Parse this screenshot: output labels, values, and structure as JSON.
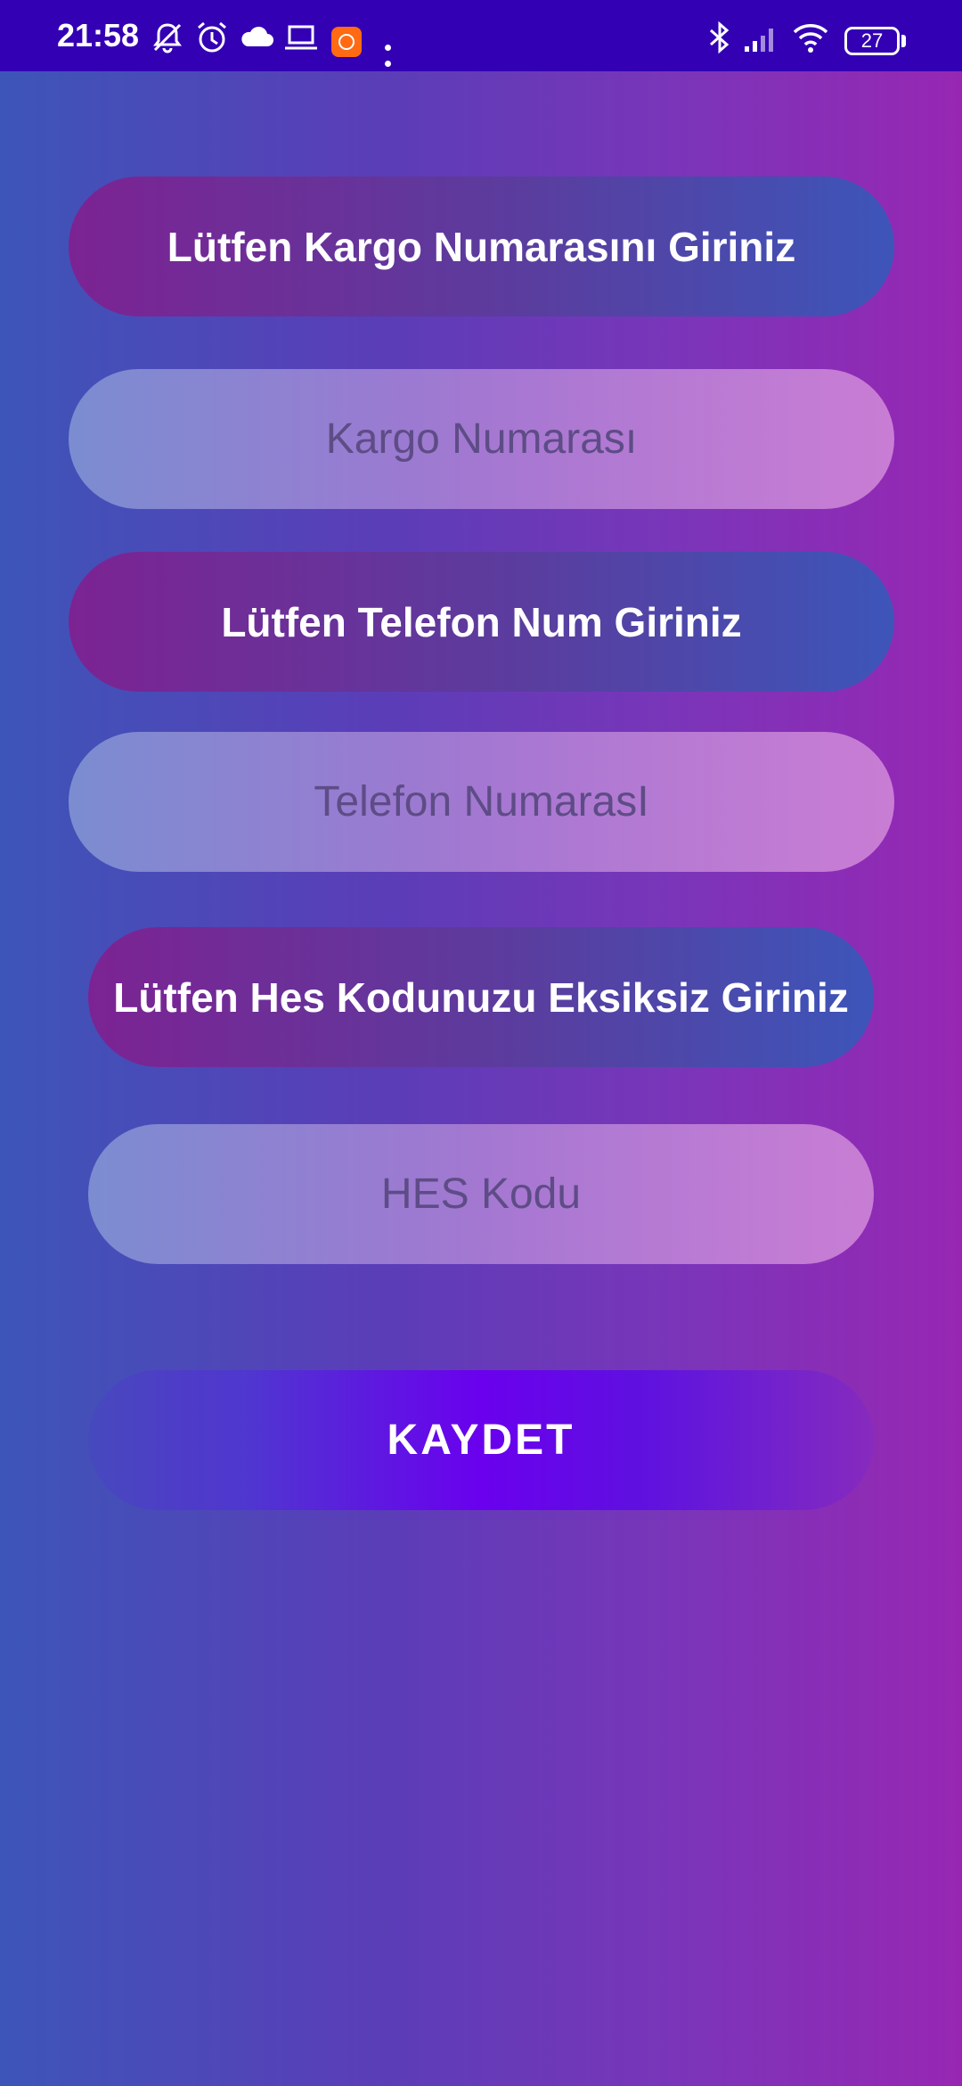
{
  "status_bar": {
    "time": "21:58",
    "battery": "27",
    "icons": [
      "mute-icon",
      "alarm-icon",
      "cloud-icon",
      "laptop-icon",
      "mi-app-icon",
      "more-dots-icon",
      "bluetooth-icon",
      "signal-icon",
      "wifi-icon",
      "battery-icon"
    ]
  },
  "form": {
    "cargo_label": "Lütfen Kargo Numarasını Giriniz",
    "cargo_placeholder": "Kargo Numarası",
    "phone_label": "Lütfen Telefon Num Giriniz",
    "phone_placeholder": "Telefon NumarasI",
    "hes_label": "Lütfen Hes Kodunuzu Eksiksiz Giriniz",
    "hes_placeholder": "HES Kodu",
    "save_label": "KAYDET"
  },
  "colors": {
    "status_bar": "#3300b3",
    "background_left": "#3d55b8",
    "background_right": "#9727b3",
    "save_button": "#6a00ee"
  }
}
